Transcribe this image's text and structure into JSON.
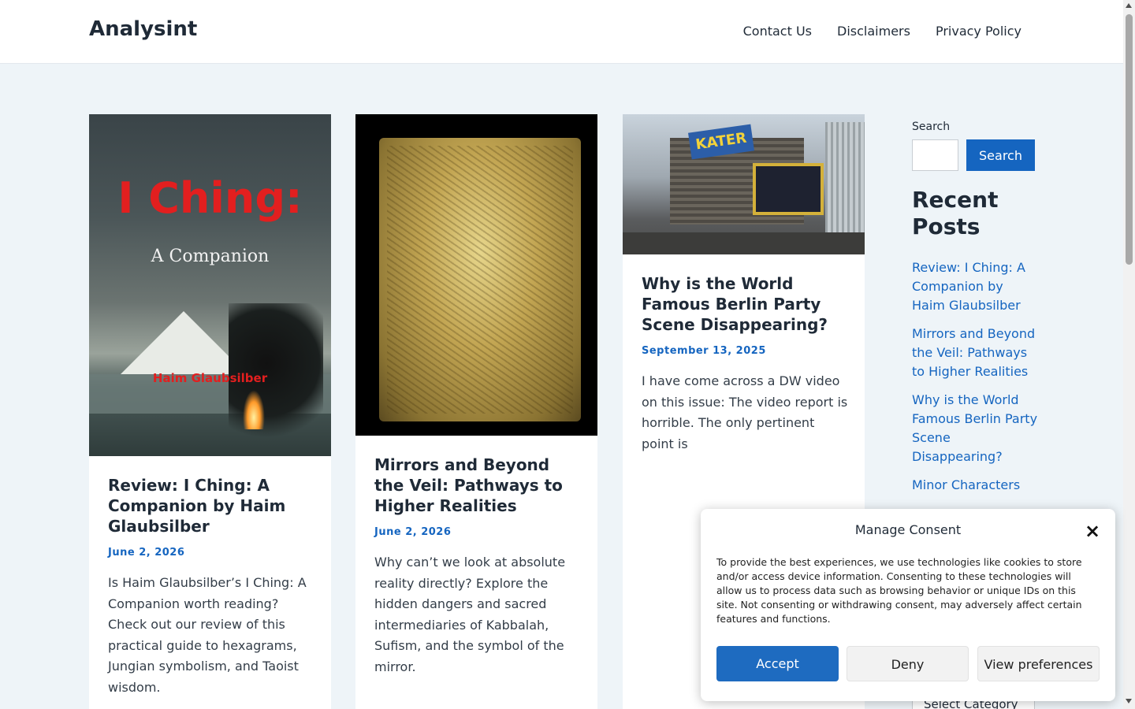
{
  "header": {
    "brand": "Analysint",
    "nav": [
      "Contact Us",
      "Disclaimers",
      "Privacy Policy"
    ]
  },
  "cover1": {
    "title": "I Ching:",
    "subtitle": "A Companion",
    "author": "Haim Glaubsilber"
  },
  "photo3": {
    "sign": "KATER"
  },
  "posts": [
    {
      "title": "Review: I Ching: A Companion by Haim Glaubsilber",
      "date": "June 2, 2026",
      "excerpt": "Is Haim Glaubsilber’s I Ching: A Companion worth reading? Check out our review of this practical guide to hexagrams, Jungian symbolism, and Taoist wisdom."
    },
    {
      "title": "Mirrors and Beyond the Veil: Pathways to Higher Realities",
      "date": "June 2, 2026",
      "excerpt": "Why can’t we look at absolute reality directly? Explore the hidden dangers and sacred intermediaries of Kabbalah, Sufism, and the symbol of the mirror."
    },
    {
      "title": "Why is the World Famous Berlin Party Scene Disappearing?",
      "date": "September 13, 2025",
      "excerpt": "I have come across a DW video on this issue: The video report is horrible. The only pertinent point is"
    }
  ],
  "sidebar": {
    "search_label": "Search",
    "search_button": "Search",
    "recent_title": "Recent Posts",
    "recent": [
      "Review: I Ching: A Companion by Haim Glaubsilber",
      "Mirrors and Beyond the Veil: Pathways to Higher Realities",
      "Why is the World Famous Berlin Party Scene Disappearing?",
      "Minor Characters"
    ],
    "category_select": "Select Category"
  },
  "consent": {
    "title": "Manage Consent",
    "close": "×",
    "text": "To provide the best experiences, we use technologies like cookies to store and/or access device information. Consenting to these technologies will allow us to process data such as browsing behavior or unique IDs on this site. Not consenting or withdrawing consent, may adversely affect certain features and functions.",
    "accept": "Accept",
    "deny": "Deny",
    "preferences": "View preferences"
  },
  "colors": {
    "accent": "#1565c0",
    "background": "#eef4f8"
  }
}
